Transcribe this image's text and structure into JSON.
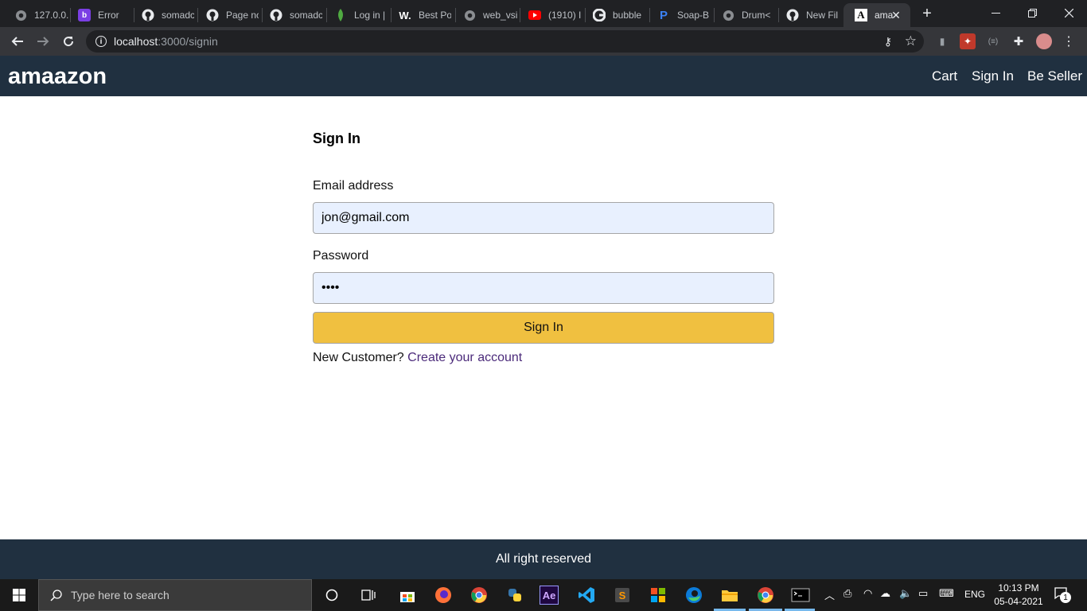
{
  "browser": {
    "tabs": [
      {
        "title": "127.0.0.",
        "icon": "globe-icon"
      },
      {
        "title": "Error",
        "icon": "b-logo-icon"
      },
      {
        "title": "somadc",
        "icon": "github-icon"
      },
      {
        "title": "Page nc",
        "icon": "github-icon"
      },
      {
        "title": "somadc",
        "icon": "github-icon"
      },
      {
        "title": "Log in |",
        "icon": "mongodb-leaf-icon"
      },
      {
        "title": "Best Po",
        "icon": "w-logo-icon"
      },
      {
        "title": "web_vsi",
        "icon": "globe-icon"
      },
      {
        "title": "(1910) I",
        "icon": "youtube-icon"
      },
      {
        "title": "bubble",
        "icon": "google-icon"
      },
      {
        "title": "Soap-B",
        "icon": "p-logo-icon"
      },
      {
        "title": "Drum<",
        "icon": "globe-icon"
      },
      {
        "title": "New Fil",
        "icon": "github-icon"
      },
      {
        "title": "ama",
        "icon": "a-logo-icon"
      }
    ],
    "url_host": "localhost",
    "url_path": ":3000/signin"
  },
  "navbar": {
    "brand": "amaazon",
    "links": {
      "cart": "Cart",
      "signin": "Sign In",
      "seller": "Be Seller"
    }
  },
  "form": {
    "title": "Sign In",
    "email_label": "Email address",
    "email_value": "jon@gmail.com",
    "password_label": "Password",
    "password_value": "****",
    "submit_label": "Sign In",
    "new_customer_text": "New Customer?",
    "create_account_link": "Create your account"
  },
  "footer": {
    "text": "All right reserved"
  },
  "taskbar": {
    "search_placeholder": "Type here to search",
    "language": "ENG",
    "time": "10:13 PM",
    "date": "05-04-2021",
    "notification_count": "1"
  },
  "colors": {
    "navbar": "#203040",
    "button": "#f0c040",
    "link": "#4b2a7a",
    "input_bg": "#e8f0fe"
  }
}
